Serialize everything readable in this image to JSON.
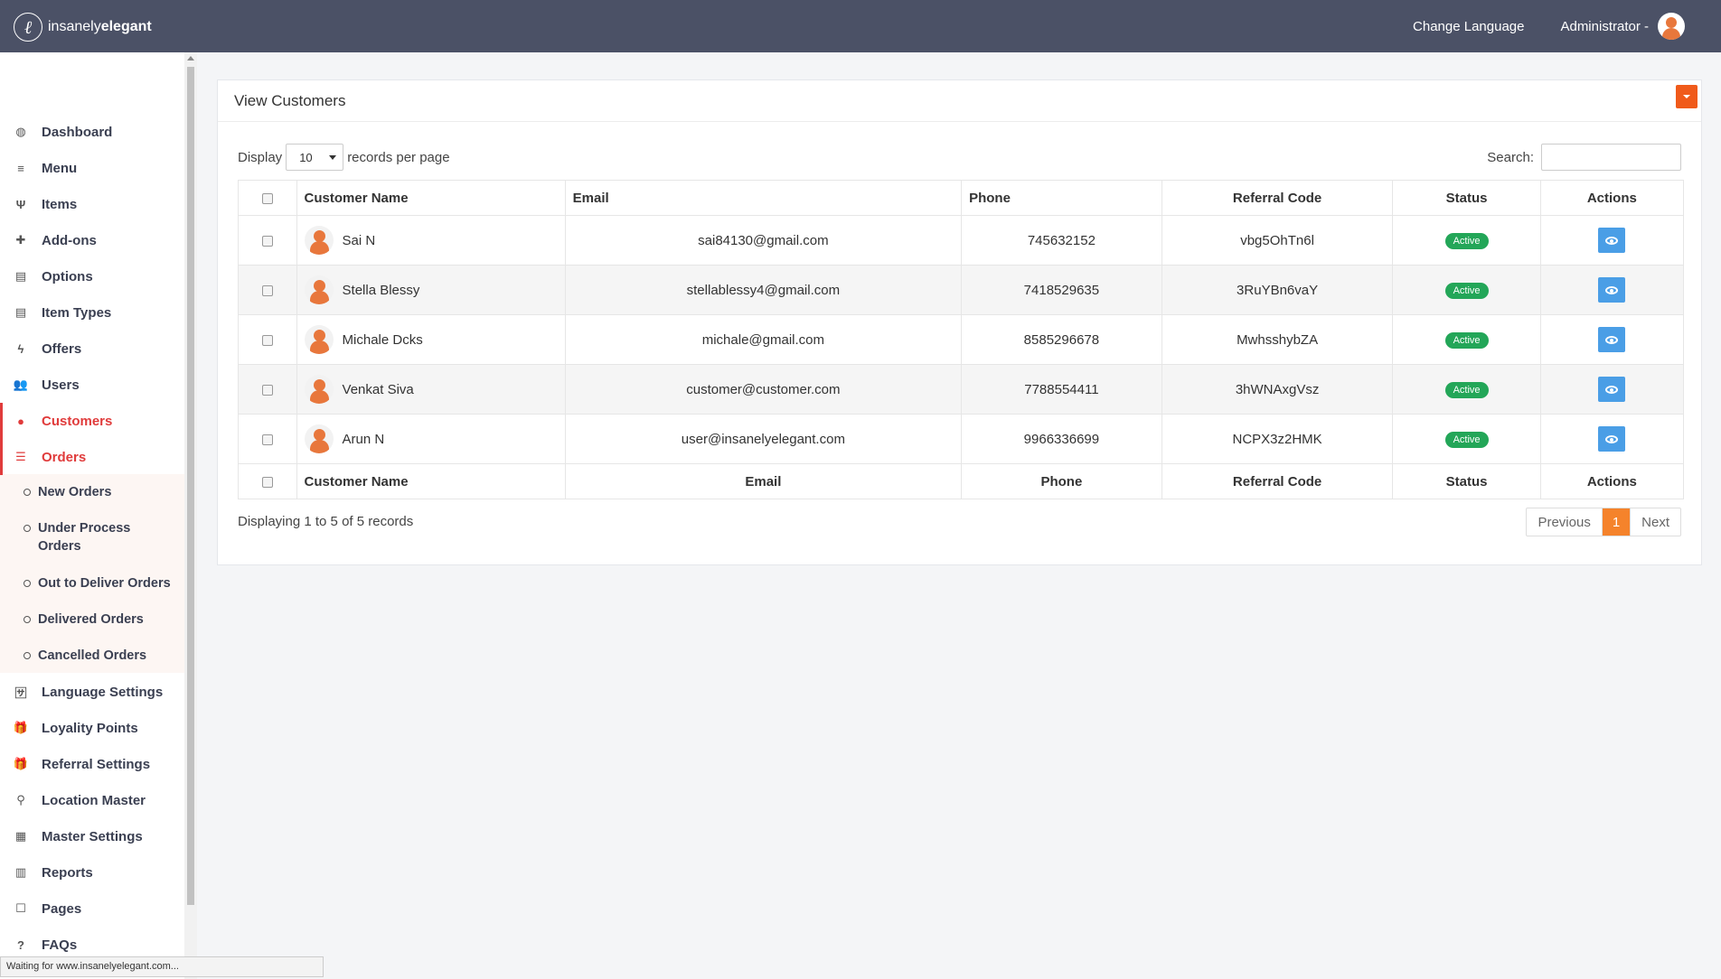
{
  "brand": {
    "mark": "ℓ",
    "name_light": "insanely",
    "name_bold": "elegant"
  },
  "header": {
    "change_language": "Change Language",
    "user": "Administrator -"
  },
  "sidebar": {
    "items": [
      {
        "label": "Dashboard",
        "icon": "dashboard-icon",
        "glyph": "◍"
      },
      {
        "label": "Menu",
        "icon": "menu-icon",
        "glyph": "≡"
      },
      {
        "label": "Items",
        "icon": "cutlery-icon",
        "glyph": "Ψ"
      },
      {
        "label": "Add-ons",
        "icon": "plus-icon",
        "glyph": "✚"
      },
      {
        "label": "Options",
        "icon": "list-icon",
        "glyph": "▤"
      },
      {
        "label": "Item Types",
        "icon": "list-icon",
        "glyph": "▤"
      },
      {
        "label": "Offers",
        "icon": "bolt-icon",
        "glyph": "ϟ"
      },
      {
        "label": "Users",
        "icon": "users-icon",
        "glyph": "👥"
      },
      {
        "label": "Customers",
        "icon": "user-icon",
        "glyph": "●"
      },
      {
        "label": "Orders",
        "icon": "list-icon",
        "glyph": "☰"
      },
      {
        "label": "Language Settings",
        "icon": "language-icon",
        "glyph": "🈂"
      },
      {
        "label": "Loyality Points",
        "icon": "gift-icon",
        "glyph": "🎁"
      },
      {
        "label": "Referral Settings",
        "icon": "gift-icon",
        "glyph": "🎁"
      },
      {
        "label": "Location Master",
        "icon": "map-marker-icon",
        "glyph": "⚲"
      },
      {
        "label": "Master Settings",
        "icon": "grid-icon",
        "glyph": "▦"
      },
      {
        "label": "Reports",
        "icon": "bar-chart-icon",
        "glyph": "▥"
      },
      {
        "label": "Pages",
        "icon": "square-icon",
        "glyph": "☐"
      },
      {
        "label": "FAQs",
        "icon": "question-icon",
        "glyph": "?"
      }
    ],
    "sub_items": [
      {
        "label": "New Orders"
      },
      {
        "label": "Under Process Orders"
      },
      {
        "label": "Out to Deliver Orders"
      },
      {
        "label": "Delivered Orders"
      },
      {
        "label": "Cancelled Orders"
      }
    ]
  },
  "panel": {
    "title": "View Customers"
  },
  "controls": {
    "display_label": "Display",
    "page_size": "10",
    "records_per_page": "records per page",
    "search_label": "Search:"
  },
  "table": {
    "columns": [
      "Customer Name",
      "Email",
      "Phone",
      "Referral Code",
      "Status",
      "Actions"
    ],
    "rows": [
      {
        "name": "Sai N",
        "email": "sai84130@gmail.com",
        "phone": "745632152",
        "code": "vbg5OhTn6l",
        "status": "Active"
      },
      {
        "name": "Stella Blessy",
        "email": "stellablessy4@gmail.com",
        "phone": "7418529635",
        "code": "3RuYBn6vaY",
        "status": "Active"
      },
      {
        "name": "Michale Dcks",
        "email": "michale@gmail.com",
        "phone": "8585296678",
        "code": "MwhsshybZA",
        "status": "Active"
      },
      {
        "name": "Venkat Siva",
        "email": "customer@customer.com",
        "phone": "7788554411",
        "code": "3hWNAxgVsz",
        "status": "Active"
      },
      {
        "name": "Arun N",
        "email": "user@insanelyelegant.com",
        "phone": "9966336699",
        "code": "NCPX3z2HMK",
        "status": "Active"
      }
    ]
  },
  "footer": {
    "info": "Displaying 1 to 5 of 5 records",
    "prev": "Previous",
    "page": "1",
    "next": "Next"
  },
  "browser_status": "Waiting for www.insanelyelegant.com...",
  "colors": {
    "topbar": "#4b5166",
    "accent": "#e03b3b",
    "orange": "#f05a1a",
    "active_badge": "#23a658",
    "view_button": "#4a9ee6"
  }
}
